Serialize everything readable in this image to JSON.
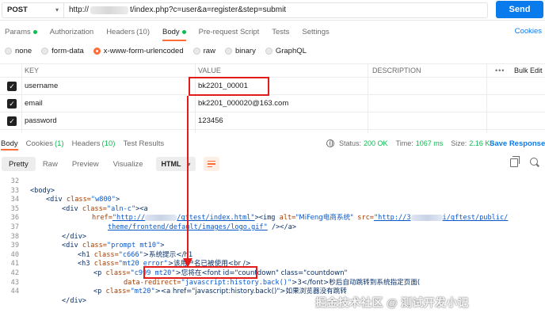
{
  "request": {
    "method": "POST",
    "url_prefix": "http://",
    "url_suffix": "t/index.php?c=user&a=register&step=submit",
    "send_label": "Send"
  },
  "request_tabs": [
    {
      "label": "Params",
      "dot": true
    },
    {
      "label": "Authorization"
    },
    {
      "label": "Headers",
      "count": "(10)"
    },
    {
      "label": "Body",
      "dot": true,
      "active": true
    },
    {
      "label": "Pre-request Script"
    },
    {
      "label": "Tests"
    },
    {
      "label": "Settings"
    }
  ],
  "cookies_label": "Cookies",
  "body_types": [
    {
      "label": "none"
    },
    {
      "label": "form-data"
    },
    {
      "label": "x-www-form-urlencoded",
      "selected": true
    },
    {
      "label": "raw"
    },
    {
      "label": "binary"
    },
    {
      "label": "GraphQL"
    }
  ],
  "params_table": {
    "headers": {
      "key": "KEY",
      "value": "VALUE",
      "description": "DESCRIPTION",
      "more": "•••",
      "bulk_edit": "Bulk Edit"
    },
    "rows": [
      {
        "key": "username",
        "value": "bk2201_00001",
        "checked": true
      },
      {
        "key": "email",
        "value": "bk2201_000020@163.com",
        "checked": true
      },
      {
        "key": "password",
        "value": "123456",
        "checked": true
      }
    ]
  },
  "response_tabs": {
    "body": "Body",
    "cookies": "Cookies",
    "cookies_count": "(1)",
    "headers": "Headers",
    "headers_count": "(10)",
    "test_results": "Test Results"
  },
  "response_status": {
    "status_label": "Status:",
    "status_value": "200 OK",
    "time_label": "Time:",
    "time_value": "1067 ms",
    "size_label": "Size:",
    "size_value": "2.16 KB",
    "save_label": "Save Response"
  },
  "view_modes": {
    "pretty": "Pretty",
    "raw": "Raw",
    "preview": "Preview",
    "visualize": "Visualize",
    "format": "HTML"
  },
  "code": {
    "n32": "32",
    "n33": "33",
    "n34": "34",
    "n35": "35",
    "n36": "36",
    "n37": "37",
    "n38": "38",
    "n39": "39",
    "n40": "40",
    "n41": "41",
    "n42": "42",
    "n43": "43",
    "n44": "44",
    "l33_tag": "<body>",
    "l34_open": "<div ",
    "l34_attr": "class=",
    "l34_val": "\"w800\"",
    "l34_close": ">",
    "l35_open": "<div ",
    "l35_attr": "class=",
    "l35_val": "\"aln-c\"",
    "l35_close": "><a",
    "l36_attr": "href=",
    "l36_val_a": "\"http://",
    "l36_val_b": "/qftest/index.html\"",
    "l36_img": "><img ",
    "l36_alt_attr": "alt=",
    "l36_alt_val": "\"MiFeng电商系统\"",
    "l36_src_attr": " src=",
    "l36_src_a": "\"http://3",
    "l36_src_b": "i/qftest/public/",
    "l37_src": "theme/frontend/default/images/logo.gif\"",
    "l37_rest": " /></a>",
    "l38_tag": "</div>",
    "l39_open": "<div ",
    "l39_attr": "class=",
    "l39_val": "\"prompt mt10\"",
    "l39_close": ">",
    "l40_open": "<h1 ",
    "l40_attr": "class=",
    "l40_val": "\"c666\"",
    "l40_text": ">系统提示</h1",
    "l41_open": "<h3 ",
    "l41_attr": "class=",
    "l41_val": "\"mt20 error\"",
    "l41_text": ">该用户名已被使用<br />",
    "l42_open": "<p ",
    "l42_attr": "class=",
    "l42_val": "\"c999 mt20\"",
    "l42_text": ">您将在<font id=\"countdown\" class=\"countdown\"",
    "l43_attr": "data-redirect=",
    "l43_val": "\"javascript:history.back()\"",
    "l43_text": ">3</font>秒后自动跳转到系统指定页面(",
    "l44_open": "<p ",
    "l44_attr": "class=",
    "l44_val": "\"mt20\"",
    "l44_text": "><a href=\"javascript:history.back()\">如果浏览器没有跳转",
    "l45_tag": "</div>"
  },
  "watermark": "掘金技术社区 @ 测试开发小记",
  "colors": {
    "accent": "#ff6c37",
    "send": "#097bed",
    "ok": "#0cbb52",
    "annotation": "#e21b1b"
  }
}
